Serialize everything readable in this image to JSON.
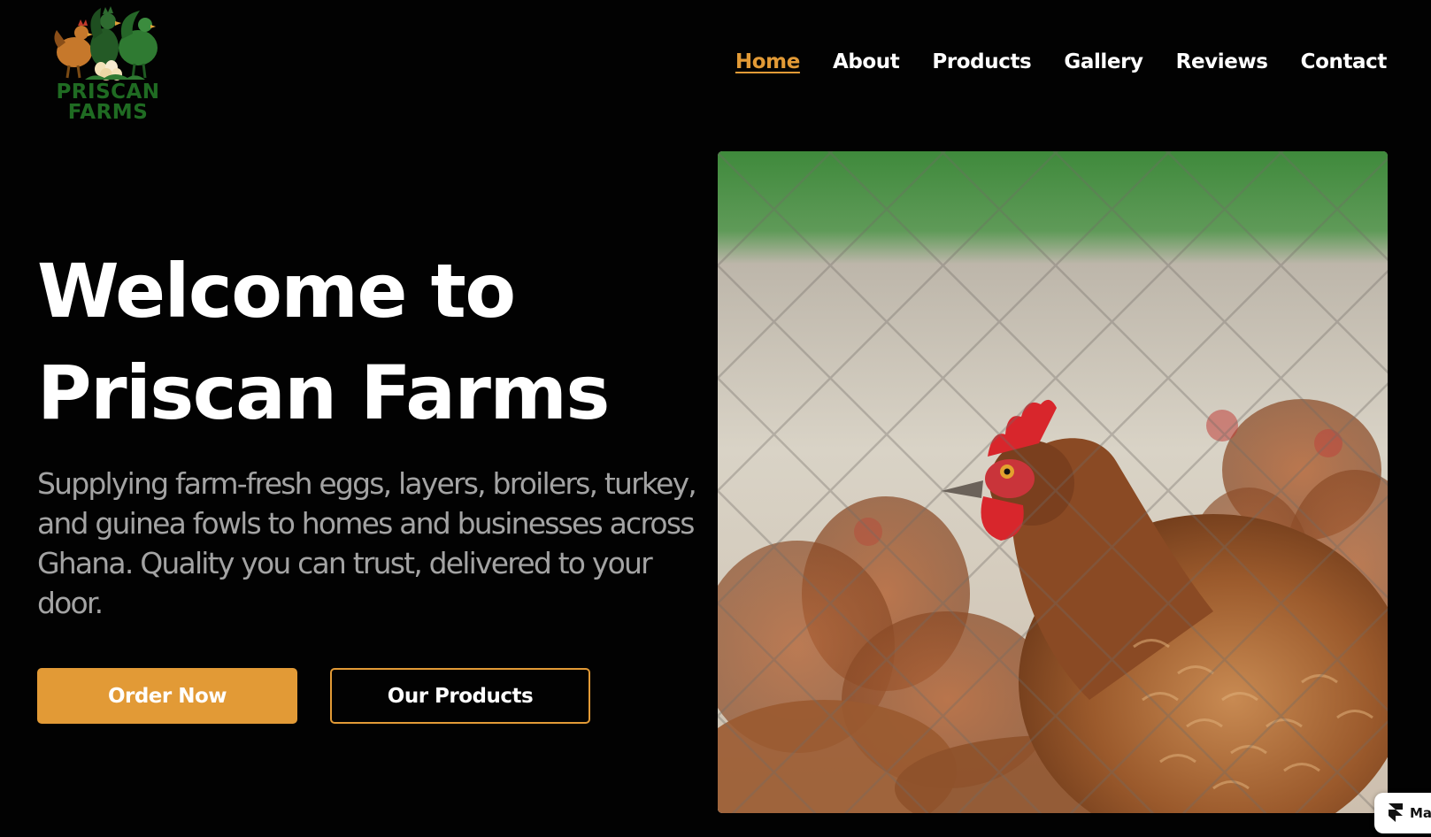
{
  "brand": {
    "logo_line1": "PRISCAN",
    "logo_line2": "FARMS",
    "logo_icon": "chickens-and-eggs-logo"
  },
  "nav": {
    "items": [
      {
        "label": "Home",
        "active": true
      },
      {
        "label": "About",
        "active": false
      },
      {
        "label": "Products",
        "active": false
      },
      {
        "label": "Gallery",
        "active": false
      },
      {
        "label": "Reviews",
        "active": false
      },
      {
        "label": "Contact",
        "active": false
      }
    ]
  },
  "hero": {
    "title_line1": "Welcome to",
    "title_line2": "Priscan Farms",
    "subtitle": "Supplying farm-fresh eggs, layers, broilers, turkey, and guinea fowls to homes and businesses across Ghana. Quality you can trust, delivered to your door.",
    "primary_button": "Order Now",
    "secondary_button": "Our Products",
    "image": "hen-behind-wire-fence-photo"
  },
  "badge": {
    "label": "Ma",
    "icon": "framer-icon"
  },
  "colors": {
    "background": "#020202",
    "accent": "#e29a36",
    "text": "#ffffff",
    "muted_text": "#a3a3a3",
    "logo_green": "#1f6b22"
  }
}
